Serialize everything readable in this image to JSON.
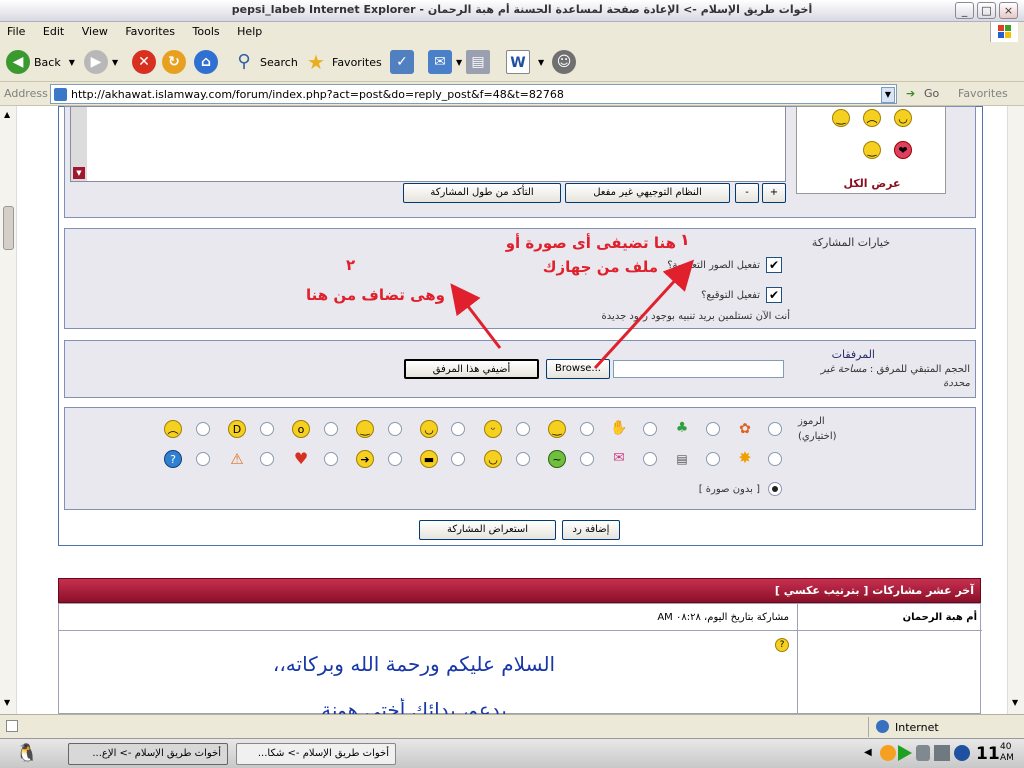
{
  "window": {
    "title": "pepsi_labeb Internet Explorer - أخوات طريق الإسلام -> الإعادة صفحة لمساعدة الحسنة أم هبة الرحمان",
    "min_label": "_",
    "max_label": "□",
    "close_label": "×"
  },
  "menu": [
    "File",
    "Edit",
    "View",
    "Favorites",
    "Tools",
    "Help"
  ],
  "toolbar": {
    "back": "Back",
    "search": "Search",
    "favorites": "Favorites"
  },
  "address": {
    "label": "Address",
    "url": "http://akhawat.islamway.com/forum/index.php?act=post&do=reply_post&f=48&t=82768",
    "go": "Go",
    "links": "Favorites"
  },
  "editor": {
    "btn_plus": "+",
    "btn_minus": "-",
    "btn_guided": "النظام التوجيهي غير مفعل",
    "btn_length": "التأكد من طول المشاركة"
  },
  "smilies_panel": {
    "show_all": "عرض الكل"
  },
  "options": {
    "heading": "خيارات المشاركة",
    "enable_emoticons": "تفعيل الصور التعبيرية؟",
    "enable_signature": "تفعيل التوقيع؟",
    "notify_text": "أنت الآن تستلمين بريد تنبيه بوجود ردود جديدة"
  },
  "attachments": {
    "heading": "المرفقات",
    "space_label": "الحجم المتبقي للمرفق",
    "space_value": "مساحة غير محددة",
    "browse_label": "Browse...",
    "add_label": "أضيفي هذا المرفق"
  },
  "annotations": {
    "one": "١",
    "two": "٢",
    "note1_line1": "هنا تضيفى أى صورة أو",
    "note1_line2": "ملف من جهازك",
    "note2": "وهى تضاف من هنا"
  },
  "icons_section": {
    "heading": "الرموز",
    "optional": "(اختياري)",
    "no_icon": "[ بدون صورة ]"
  },
  "buttons": {
    "submit": "إضافة رد",
    "preview": "استعراض المشاركة"
  },
  "last_posts": {
    "header": "آخر عشر مشاركات [ بترتيب عكسي ]",
    "author": "أم هبة الرحمان",
    "date": "مشاركة بتاريخ اليوم، ٠٨:٢٨ AM",
    "body_line1": "السلام عليكم ورحمة الله وبركاته،،",
    "body_line2": "بدعو، بدائك أختي هونة"
  },
  "status": {
    "zone": "Internet"
  },
  "taskbar": {
    "task1": "أخوات طريق الإسلام -> الإع...",
    "task2": "أخوات طريق الإسلام -> شكا...",
    "clock": "11:40 AM",
    "clock_main": "11",
    "clock_sub": "40",
    "clock_ampm": "AM"
  },
  "colors": {
    "red_annotation": "#e0202c",
    "header_bar": "#a01830",
    "frame_border": "#8090b8"
  }
}
